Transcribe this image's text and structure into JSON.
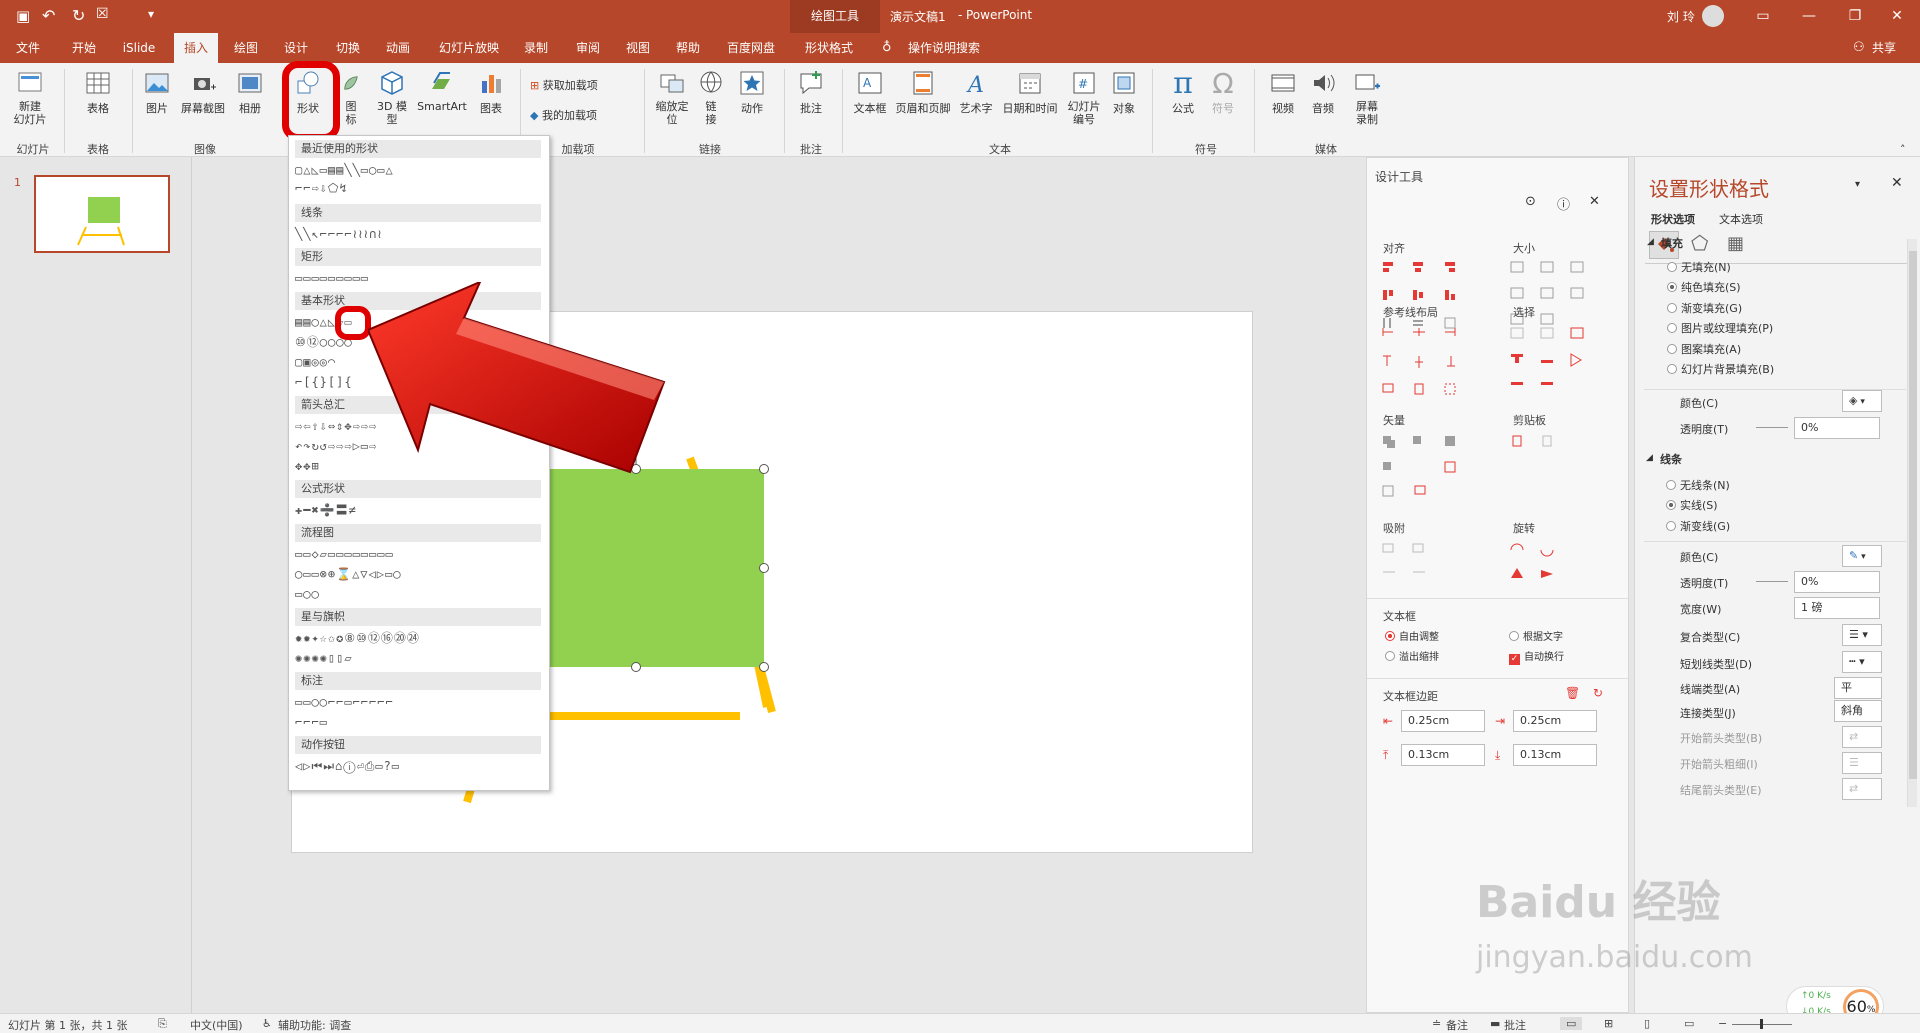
{
  "titlebar": {
    "context_tab": "绘图工具",
    "doc_title": "演示文稿1",
    "separator": "-",
    "app_name": "PowerPoint",
    "user": "刘 玲"
  },
  "tabs": [
    "文件",
    "开始",
    "iSlide",
    "插入",
    "绘图",
    "设计",
    "切换",
    "动画",
    "幻灯片放映",
    "录制",
    "审阅",
    "视图",
    "帮助",
    "百度网盘",
    "形状格式"
  ],
  "active_tab": "插入",
  "tell_me": "操作说明搜索",
  "share": "共享",
  "ribbon": {
    "new_slide": "新建\n幻灯片",
    "table": "表格",
    "picture": "图片",
    "screenshot": "屏幕截图",
    "album": "相册",
    "shapes": "形状",
    "icons": "图\n标",
    "3d": "3D 模\n型",
    "smartart": "SmartArt",
    "chart": "图表",
    "get_addins": "获取加载项",
    "my_addins": "我的加载项",
    "zoom": "缩放定\n位",
    "link": "链\n接",
    "action": "动作",
    "comment": "批注",
    "textbox": "文本框",
    "header_footer": "页眉和页脚",
    "wordart": "艺术字",
    "datetime": "日期和时间",
    "slide_number": "幻灯片\n编号",
    "object": "对象",
    "equation": "公式",
    "symbol": "符号",
    "video": "视频",
    "audio": "音频",
    "screen_record": "屏幕\n录制",
    "groups": {
      "slides": "幻灯片",
      "tables": "表格",
      "images": "图像",
      "addins": "加载项",
      "links": "链接",
      "comments": "批注",
      "text": "文本",
      "symbols": "符号",
      "media": "媒体"
    }
  },
  "thumbnail": {
    "number": "1"
  },
  "shapes_menu": {
    "categories": [
      "最近使用的形状",
      "线条",
      "矩形",
      "基本形状",
      "箭头总汇",
      "公式形状",
      "流程图",
      "星与旗帜",
      "标注",
      "动作按钮"
    ],
    "rows": [
      "▢△◺▭▤▤╲╲▭◯▭△",
      "⌐⌐⇨⇩⬠↯",
      "╲╲↖⌐⌐⌐⌐≀≀≀∩≀",
      "▭▭▭▭▭▭▭▭▭",
      "▤▤◯△◺▱▭",
      "⑩⑫◯◯◯◯",
      "▢▣◎◎◠",
      "⌐[{}[]{",
      "⇨⇦⇧⇩⇔⇕✥⇨⇨⇨",
      "↶↷↻↺⇨⇨⇨▷▭⇨",
      "✥✥⊞",
      "✚━✖➗〓≠",
      "▭▭◇▱▭▭▭▭▭▭▭▭",
      "◯▭▭⊗⊕⌛△▽◁▷▭◯",
      "▭◯◯",
      "✹✹✦☆✩✪⑧⑩⑫⑯⑳㉔",
      "✺✺✺✺▯▯▱",
      "▭▭◯◯⌐⌐▭⌐⌐⌐⌐⌐",
      "⌐⌐⌐▭",
      "◁▷⏮⏭⌂ⓘ⏎⎙▭?▭"
    ]
  },
  "design_pane": {
    "title": "设计工具",
    "align": "对齐",
    "size": "大小",
    "guides": "参考线布局",
    "select": "选择",
    "vector": "矢量",
    "clipboard": "剪贴板",
    "snap": "吸附",
    "rotate": "旋转",
    "textbox_section": "文本框",
    "auto_fit": "自由调整",
    "fit_text": "根据文字",
    "shrink_overflow": "溢出缩排",
    "auto_wrap": "自动换行",
    "margins": "文本框边距",
    "margin_left": "0.25cm",
    "margin_right": "0.25cm",
    "margin_top": "0.13cm",
    "margin_bottom": "0.13cm"
  },
  "format_pane": {
    "title": "设置形状格式",
    "tab_shape": "形状选项",
    "tab_text": "文本选项",
    "fill_header": "填充",
    "fill_options": [
      "无填充(N)",
      "纯色填充(S)",
      "渐变填充(G)",
      "图片或纹理填充(P)",
      "图案填充(A)",
      "幻灯片背景填充(B)"
    ],
    "fill_selected": 1,
    "color_label": "颜色(C)",
    "transparency_label": "透明度(T)",
    "fill_transparency": "0%",
    "line_header": "线条",
    "line_options": [
      "无线条(N)",
      "实线(S)",
      "渐变线(G)"
    ],
    "line_selected": 1,
    "line_color_label": "颜色(C)",
    "line_transparency_label": "透明度(T)",
    "line_transparency": "0%",
    "width_label": "宽度(W)",
    "width_value": "1 磅",
    "compound_label": "复合类型(C)",
    "dash_label": "短划线类型(D)",
    "cap_label": "线端类型(A)",
    "cap_value": "平",
    "join_label": "连接类型(J)",
    "join_value": "斜角",
    "begin_arrow_label": "开始箭头类型(B)",
    "begin_size_label": "开始箭头粗细(I)",
    "end_arrow_label": "结尾箭头类型(E)"
  },
  "status": {
    "slide_info": "幻灯片 第 1 张，共 1 张",
    "language": "中文(中国)",
    "accessibility": "辅助功能: 调查",
    "notes": "备注",
    "comments": "批注",
    "zoom": "60",
    "zoom_unit": "%",
    "net_up": "0  K/s",
    "net_down": "0  K/s"
  },
  "watermark": {
    "brand": "Baidu 经验",
    "url": "jingyan.baidu.com"
  },
  "colors": {
    "accent": "#b7472a",
    "shape_fill": "#92d050",
    "easel": "#ffc000",
    "highlight": "#e00000"
  }
}
